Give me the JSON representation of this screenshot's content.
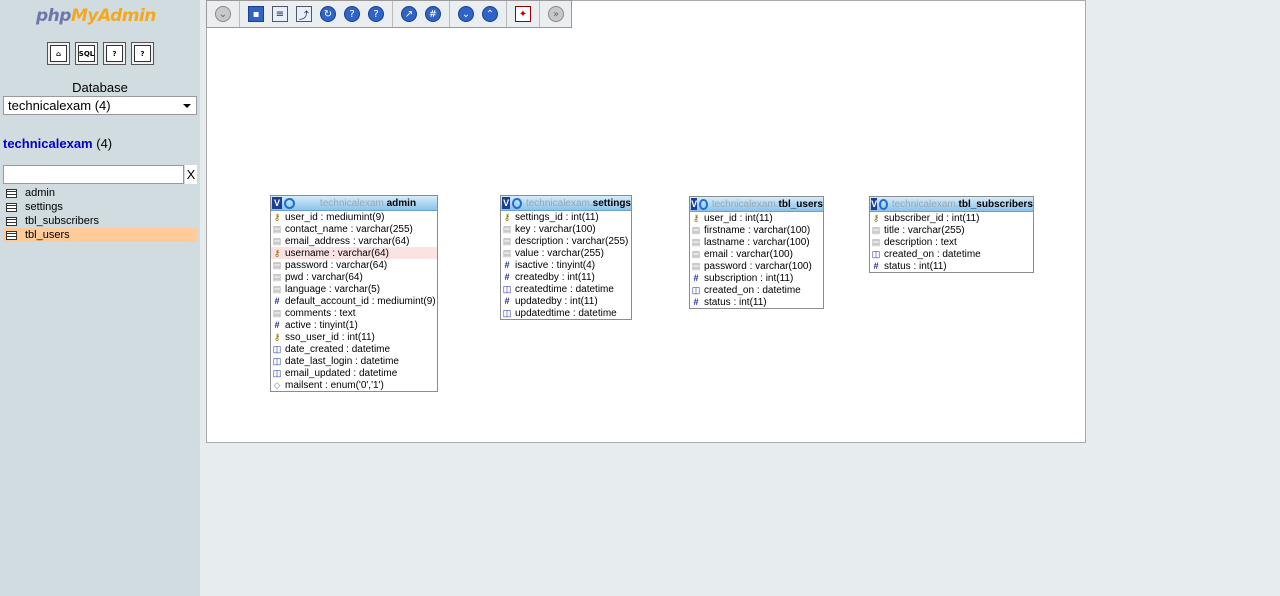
{
  "logo": {
    "part1": "php",
    "part2": "MyAdmin"
  },
  "quick_icons": [
    {
      "name": "home-icon",
      "glyph": "⌂"
    },
    {
      "name": "sql-query-icon",
      "glyph": "SQL"
    },
    {
      "name": "help-icon",
      "glyph": "?"
    },
    {
      "name": "documentation-icon",
      "glyph": "?"
    }
  ],
  "sidebar": {
    "database_label": "Database",
    "database_select_value": "technicalexam (4)",
    "db_name": "technicalexam",
    "db_count": "(4)",
    "filter_placeholder": "",
    "filter_clear": "X",
    "tables": [
      {
        "label": "admin",
        "active": false
      },
      {
        "label": "settings",
        "active": false
      },
      {
        "label": "tbl_subscribers",
        "active": false
      },
      {
        "label": "tbl_users",
        "active": true
      }
    ]
  },
  "toolbar": {
    "buttons": [
      "show-all-icon",
      "save-position-icon",
      "create-table-icon",
      "create-relation-icon",
      "reload-icon",
      "help-icon",
      "angular-links-icon",
      "snap-to-grid-icon",
      "small-big-all-icon",
      "toggle-small-big-icon",
      "export-pdf-icon",
      "move-menu-icon"
    ]
  },
  "designer_tables": [
    {
      "db": "technicalexam.",
      "name": "admin",
      "columns": [
        {
          "type": "key",
          "text": "user_id : mediumint(9)"
        },
        {
          "type": "str",
          "text": "contact_name : varchar(255)"
        },
        {
          "type": "str",
          "text": "email_address : varchar(64)"
        },
        {
          "type": "key",
          "text": "username : varchar(64)",
          "highlight": true
        },
        {
          "type": "str",
          "text": "password : varchar(64)"
        },
        {
          "type": "str",
          "text": "pwd : varchar(64)"
        },
        {
          "type": "str",
          "text": "language : varchar(5)"
        },
        {
          "type": "int",
          "text": "default_account_id : mediumint(9)"
        },
        {
          "type": "str",
          "text": "comments : text"
        },
        {
          "type": "int",
          "text": "active : tinyint(1)"
        },
        {
          "type": "key",
          "text": "sso_user_id : int(11)"
        },
        {
          "type": "date",
          "text": "date_created : datetime"
        },
        {
          "type": "date",
          "text": "date_last_login : datetime"
        },
        {
          "type": "date",
          "text": "email_updated : datetime"
        },
        {
          "type": "enum",
          "text": "mailsent : enum('0','1')"
        }
      ]
    },
    {
      "db": "technicalexam.",
      "name": "settings",
      "columns": [
        {
          "type": "key",
          "text": "settings_id : int(11)"
        },
        {
          "type": "str",
          "text": "key : varchar(100)"
        },
        {
          "type": "str",
          "text": "description : varchar(255)"
        },
        {
          "type": "str",
          "text": "value : varchar(255)"
        },
        {
          "type": "int",
          "text": "isactive : tinyint(4)"
        },
        {
          "type": "int",
          "text": "createdby : int(11)"
        },
        {
          "type": "date",
          "text": "createdtime : datetime"
        },
        {
          "type": "int",
          "text": "updatedby : int(11)"
        },
        {
          "type": "date",
          "text": "updatedtime : datetime"
        }
      ]
    },
    {
      "db": "technicalexam.",
      "name": "tbl_users",
      "columns": [
        {
          "type": "key",
          "text": "user_id : int(11)"
        },
        {
          "type": "str",
          "text": "firstname : varchar(100)"
        },
        {
          "type": "str",
          "text": "lastname : varchar(100)"
        },
        {
          "type": "str",
          "text": "email : varchar(100)"
        },
        {
          "type": "str",
          "text": "password : varchar(100)"
        },
        {
          "type": "int",
          "text": "subscription : int(11)"
        },
        {
          "type": "date",
          "text": "created_on : datetime"
        },
        {
          "type": "int",
          "text": "status : int(11)"
        }
      ]
    },
    {
      "db": "technicalexam.",
      "name": "tbl_subscribers",
      "columns": [
        {
          "type": "key",
          "text": "subscriber_id : int(11)"
        },
        {
          "type": "str",
          "text": "title : varchar(255)"
        },
        {
          "type": "str",
          "text": "description : text"
        },
        {
          "type": "date",
          "text": "created_on : datetime"
        },
        {
          "type": "int",
          "text": "status : int(11)"
        }
      ]
    }
  ]
}
